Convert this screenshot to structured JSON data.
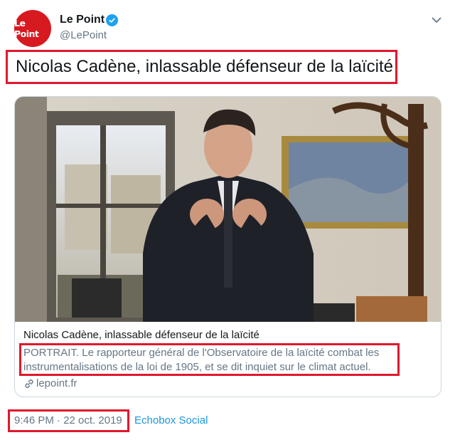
{
  "account": {
    "avatar_text": "Le Point",
    "name": "Le Point",
    "handle": "@LePoint",
    "verified": true
  },
  "icons": {
    "verified": "verified-badge-icon",
    "caret": "chevron-down-icon",
    "link": "link-icon"
  },
  "tweet": {
    "text": "Nicolas Cadène, inlassable défenseur de la laïcité",
    "timestamp": "9:46 PM · 22 oct. 2019",
    "source": "Echobox Social"
  },
  "card": {
    "title": "Nicolas Cadène, inlassable défenseur de la laïcité",
    "description": "PORTRAIT. Le rapporteur général de l'Observatoire de la laïcité combat les instrumentalisations de la loi de 1905, et se dit inquiet sur le climat actuel.",
    "domain": "lepoint.fr"
  },
  "colors": {
    "brand_red": "#d71920",
    "verified_blue": "#1da1f2",
    "link_blue": "#1b95e0",
    "muted": "#657786",
    "highlight_red": "#e0182d"
  }
}
